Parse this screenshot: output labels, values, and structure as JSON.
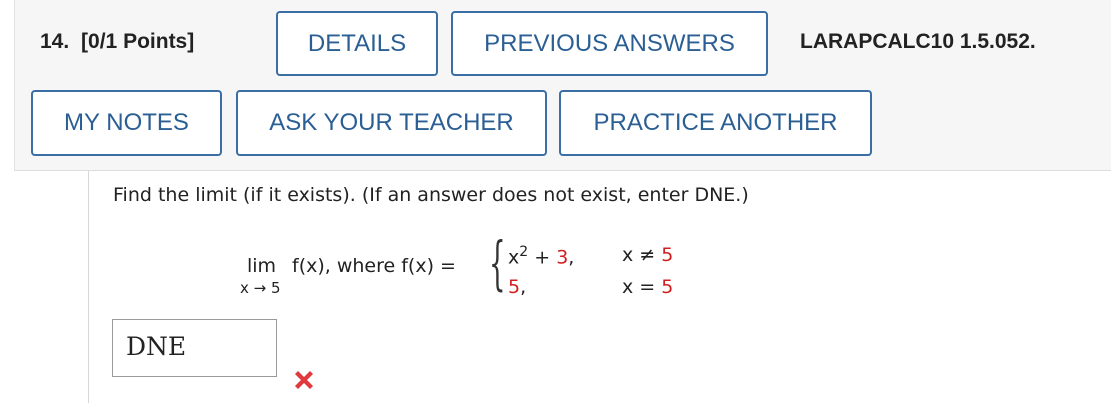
{
  "header": {
    "question_number": "14.",
    "points": "[0/1 Points]",
    "code": "LARAPCALC10 1.5.052.",
    "buttons": {
      "details": "DETAILS",
      "previous_answers": "PREVIOUS ANSWERS",
      "my_notes": "MY NOTES",
      "ask_teacher": "ASK YOUR TEACHER",
      "practice_another": "PRACTICE ANOTHER"
    }
  },
  "question": {
    "prompt": "Find the limit (if it exists). (If an answer does not exist, enter DNE.)",
    "lim": "lim",
    "lim_sub": "x → 5",
    "fx": "f(x), where f(x) =",
    "case1_expr": "x",
    "case1_exp": "2",
    "case1_plus": "+",
    "case1_const": "3",
    "case1_cond_var": "x ≠",
    "case1_cond_val": "5",
    "case2_expr": "5",
    "case2_cond_var": "x =",
    "case2_cond_val": "5"
  },
  "answer": {
    "value": "DNE",
    "status_icon": "x-mark-icon",
    "status_color": "#e0393e"
  },
  "colors": {
    "accent": "#3a6ea5",
    "highlight_red": "#d21f1f"
  }
}
